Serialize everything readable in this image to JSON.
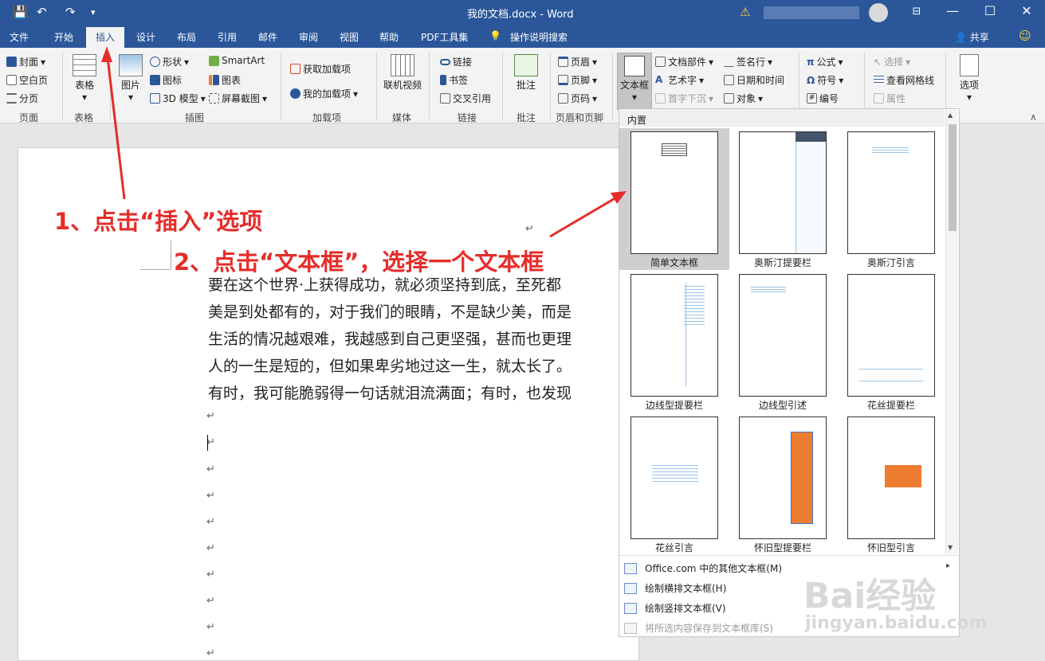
{
  "window": {
    "title": "我的文档.docx - Word",
    "share": "共享"
  },
  "tabs": [
    "文件",
    "开始",
    "插入",
    "设计",
    "布局",
    "引用",
    "邮件",
    "审阅",
    "视图",
    "帮助",
    "PDF工具集",
    "操作说明搜索"
  ],
  "ribbon": {
    "page_group": {
      "items": [
        "封面",
        "空白页",
        "分页"
      ],
      "label": "页面"
    },
    "table_group": {
      "button": "表格",
      "label": "表格"
    },
    "illustrations_group": {
      "picture": "图片",
      "items": [
        "形状",
        "图标",
        "3D 模型",
        "SmartArt",
        "图表",
        "屏幕截图"
      ],
      "label": "插图"
    },
    "addins_group": {
      "items": [
        "获取加载项",
        "我的加载项"
      ],
      "label": "加载项"
    },
    "media_group": {
      "button": "联机视频",
      "label": "媒体"
    },
    "links_group": {
      "items": [
        "链接",
        "书签",
        "交叉引用"
      ],
      "label": "链接"
    },
    "comments_group": {
      "button": "批注",
      "label": "批注"
    },
    "header_footer_group": {
      "items": [
        "页眉",
        "页脚",
        "页码"
      ],
      "label": "页眉和页脚"
    },
    "text_group": {
      "textbox": "文本框",
      "items": [
        "文档部件",
        "艺术字",
        "首字下沉",
        "签名行",
        "日期和时间",
        "对象"
      ]
    },
    "symbols_group": {
      "items": [
        "公式",
        "符号",
        "编号"
      ]
    },
    "misc_group": {
      "items": [
        "选择",
        "查看网格线",
        "属性"
      ]
    },
    "options": "选项"
  },
  "document": {
    "paragraphs": [
      "要在这个世界·上获得成功，就必须坚持到底，至死都",
      "美是到处都有的，对于我们的眼睛，不是缺少美，而是",
      "生活的情况越艰难，我越感到自己更坚强，甚而也更理",
      "人的一生是短的，但如果卑劣地过这一生，就太长了。",
      "有时，我可能脆弱得一句话就泪流满面；有时，也发现"
    ],
    "para_mark": "↵"
  },
  "annotations": {
    "step1": "1、点击“插入”选项",
    "step2": "2、点击“文本框”，选择一个文本框"
  },
  "textbox_menu": {
    "section": "内置",
    "gallery": [
      "简单文本框",
      "奥斯汀提要栏",
      "奥斯汀引言",
      "边线型提要栏",
      "边线型引述",
      "花丝提要栏",
      "花丝引言",
      "怀旧型提要栏",
      "怀旧型引言"
    ],
    "selected": "简单文本框",
    "commands": [
      {
        "label": "Office.com 中的其他文本框(M)",
        "enabled": true
      },
      {
        "label": "绘制横排文本框(H)",
        "enabled": true
      },
      {
        "label": "绘制竖排文本框(V)",
        "enabled": true
      },
      {
        "label": "将所选内容保存到文本框库(S)",
        "enabled": false
      }
    ]
  },
  "watermark": {
    "brand": "Bai经验",
    "url": "jingyan.baidu.com"
  },
  "colors": {
    "word_blue": "#2b579a",
    "annotation_red": "#e52d2a",
    "accent_orange": "#ed7d31"
  }
}
